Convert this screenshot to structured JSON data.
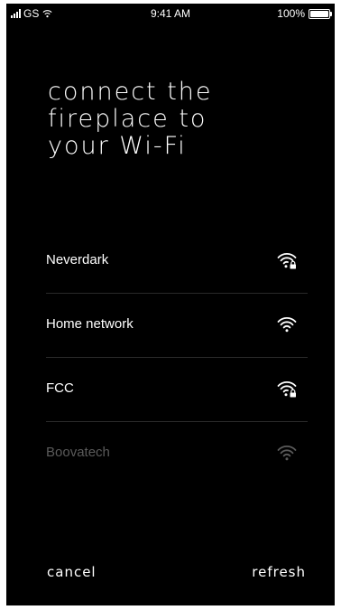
{
  "status_bar": {
    "carrier": "GS",
    "time": "9:41 AM",
    "battery": "100%",
    "signal_icon": "cellular-signal-icon",
    "wifi_icon": "wifi-icon",
    "battery_icon": "battery-full-icon"
  },
  "title": {
    "line1": "connect the",
    "line2": "fireplace to",
    "line3": "your Wi-Fi"
  },
  "networks": [
    {
      "name": "Neverdark",
      "icon": "wifi-locked-icon",
      "secured": true,
      "available": true
    },
    {
      "name": "Home network",
      "icon": "wifi-icon",
      "secured": false,
      "available": true
    },
    {
      "name": "FCC",
      "icon": "wifi-locked-icon",
      "secured": true,
      "available": true
    },
    {
      "name": "Boovatech",
      "icon": "wifi-icon",
      "secured": false,
      "available": false
    }
  ],
  "footer": {
    "cancel_label": "cancel",
    "refresh_label": "refresh"
  },
  "colors": {
    "background": "#000000",
    "text": "#ffffff",
    "dim_text": "#5a5a5a",
    "divider": "#2a2a2a"
  }
}
